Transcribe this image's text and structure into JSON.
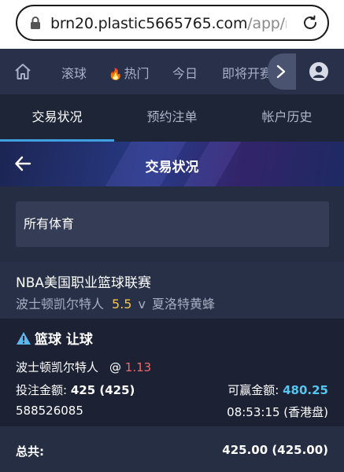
{
  "browser": {
    "url_host": "brn20.plastic5665765.com",
    "url_path": "/app/m"
  },
  "topnav": {
    "items": [
      {
        "label": "滚球"
      },
      {
        "label": "热门",
        "icon": "fire-icon"
      },
      {
        "label": "今日"
      },
      {
        "label": "即将开赛"
      }
    ]
  },
  "subtabs": [
    {
      "label": "交易状况"
    },
    {
      "label": "预约注单"
    },
    {
      "label": "帐户历史"
    }
  ],
  "header": {
    "title": "交易状况"
  },
  "filter": {
    "selected": "所有体育"
  },
  "match": {
    "league": "NBA美国职业篮球联赛",
    "home": "波士顿凯尔特人",
    "line": "5.5",
    "vs": "v",
    "away": "夏洛特黄蜂"
  },
  "bet": {
    "type": "篮球 让球",
    "selection": "波士顿凯尔特人",
    "at": "@",
    "odds": "1.13",
    "stake_label": "投注金额:",
    "stake_value": "425 (425)",
    "win_label": "可赢金额:",
    "win_value": "480.25",
    "ticket_id": "588526085",
    "time": "08:53:15 (香港盘)"
  },
  "total": {
    "label": "总共:",
    "value": "425.00 (425.00)"
  },
  "colors": {
    "accent": "#3fa0e2",
    "odds": "#ef6a6a",
    "line": "#f3c549",
    "win": "#56c6f0"
  }
}
